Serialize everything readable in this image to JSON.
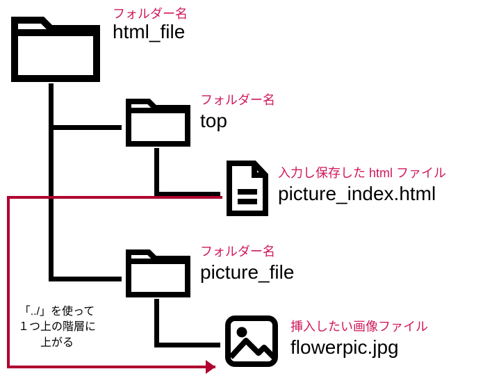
{
  "annotations": {
    "folder_label": "フォルダー名",
    "html_file_label": "入力し保存した html ファイル",
    "image_file_label": "挿入したい画像ファイル"
  },
  "tree": {
    "root": {
      "name": "html_file"
    },
    "folder_top": {
      "name": "top"
    },
    "file_html": {
      "name": "picture_index.html"
    },
    "folder_picture": {
      "name": "picture_file"
    },
    "file_image": {
      "name": "flowerpic.jpg"
    }
  },
  "arrow_note": {
    "line1": "「../」を使って",
    "line2": "１つ上の階層に",
    "line3": "上がる"
  },
  "colors": {
    "accent": "#d0175a",
    "ink": "#000000",
    "arrow": "#b00030"
  }
}
